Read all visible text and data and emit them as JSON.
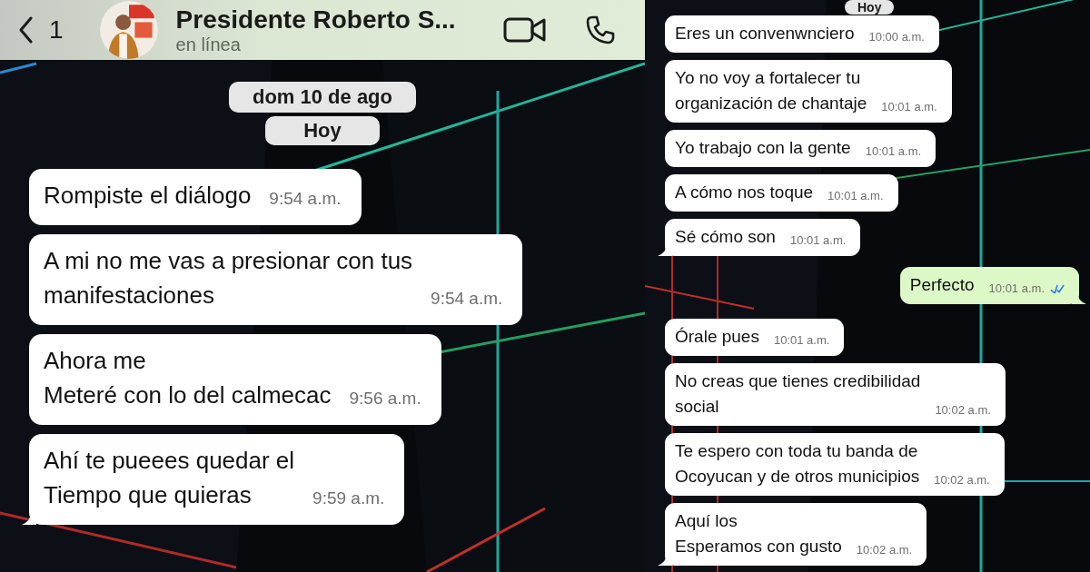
{
  "left_panel": {
    "header": {
      "back_count": "1",
      "contact_name": "Presidente Roberto S...",
      "status": "en línea"
    },
    "date_chips": [
      "dom 10 de ago",
      "Hoy"
    ],
    "messages": [
      {
        "kind": "incoming",
        "text": "Rompiste el diálogo",
        "time": "9:54 a.m.",
        "tail": false
      },
      {
        "kind": "incoming",
        "text": "A mi no me vas a presionar con tus\nmanifestaciones",
        "time": "9:54 a.m.",
        "tail": false
      },
      {
        "kind": "incoming",
        "text": "Ahora me\nMeteré con lo del calmecac",
        "time": "9:56 a.m.",
        "tail": false
      },
      {
        "kind": "incoming",
        "text": "Ahí te pueees quedar el\nTiempo que quieras",
        "time": "9:59 a.m.",
        "tail": true
      }
    ]
  },
  "right_panel": {
    "date_chips": [
      "Hoy"
    ],
    "messages": [
      {
        "kind": "incoming",
        "text": "Eres un convenwnciero",
        "time": "10:00 a.m.",
        "tail": false
      },
      {
        "kind": "incoming",
        "text": "Yo no voy a fortalecer tu\norganización de chantaje",
        "time": "10:01 a.m.",
        "tail": false
      },
      {
        "kind": "incoming",
        "text": "Yo trabajo con la gente",
        "time": "10:01 a.m.",
        "tail": false
      },
      {
        "kind": "incoming",
        "text": "A cómo nos toque",
        "time": "10:01 a.m.",
        "tail": false
      },
      {
        "kind": "incoming",
        "text": "Sé cómo son",
        "time": "10:01 a.m.",
        "tail": true
      },
      {
        "kind": "outgoing",
        "text": "Perfecto",
        "time": "10:01 a.m.",
        "tail": true,
        "read": true
      },
      {
        "kind": "incoming",
        "text": "Órale pues",
        "time": "10:01 a.m.",
        "tail": false
      },
      {
        "kind": "incoming",
        "text": "No creas que tienes credibilidad\nsocial",
        "time": "10:02 a.m.",
        "tail": false
      },
      {
        "kind": "incoming",
        "text": "Te espero con toda tu banda de\nOcoyucan y de otros municipios",
        "time": "10:02 a.m.",
        "tail": false
      },
      {
        "kind": "incoming",
        "text": "Aquí los\nEsperamos con gusto",
        "time": "10:02 a.m.",
        "tail": true
      }
    ]
  }
}
